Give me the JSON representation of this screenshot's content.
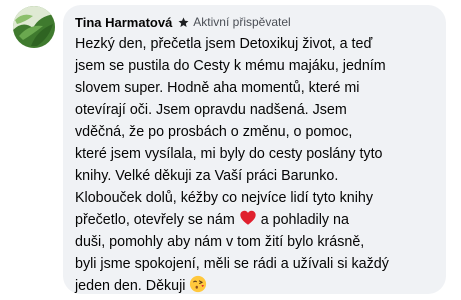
{
  "comment": {
    "author": "Tina Harmatová",
    "badge": {
      "label": "Aktivní přispěvatel",
      "icon": "star-icon"
    },
    "avatar": {
      "icon": "plant-avatar"
    },
    "lines": [
      "Hezký den, přečetla jsem Detoxikuj život, a teď",
      "jsem se pustila do Cesty k mému majáku, jedním",
      "slovem super. Hodně aha momentů, které mi",
      "otevírají oči. Jsem opravdu nadšená. Jsem",
      "vděčná, že po prosbách o změnu, o pomoc,",
      "které jsem vysílala, mi byly do cesty poslány tyto",
      "knihy. Velké děkuji za Vaší práci Barunko.",
      "Klobouček dolů, kéžby co nejvíce lidí tyto knihy",
      "přečetlo, otevřely se nám",
      "a pohladily na",
      "duši, pomohly aby nám v tom žití bylo krásně,",
      "byli jsme spokojení, měli se rádi a užívali si každý",
      "jeden den. Děkuji"
    ],
    "emojis": {
      "heart": "heart-emoji",
      "kiss": "kissing-face-emoji"
    },
    "colors": {
      "bubble": "#f0f2f5",
      "text": "#050505",
      "heart": "#e0202e",
      "avatar": "#4f8a3a"
    }
  }
}
